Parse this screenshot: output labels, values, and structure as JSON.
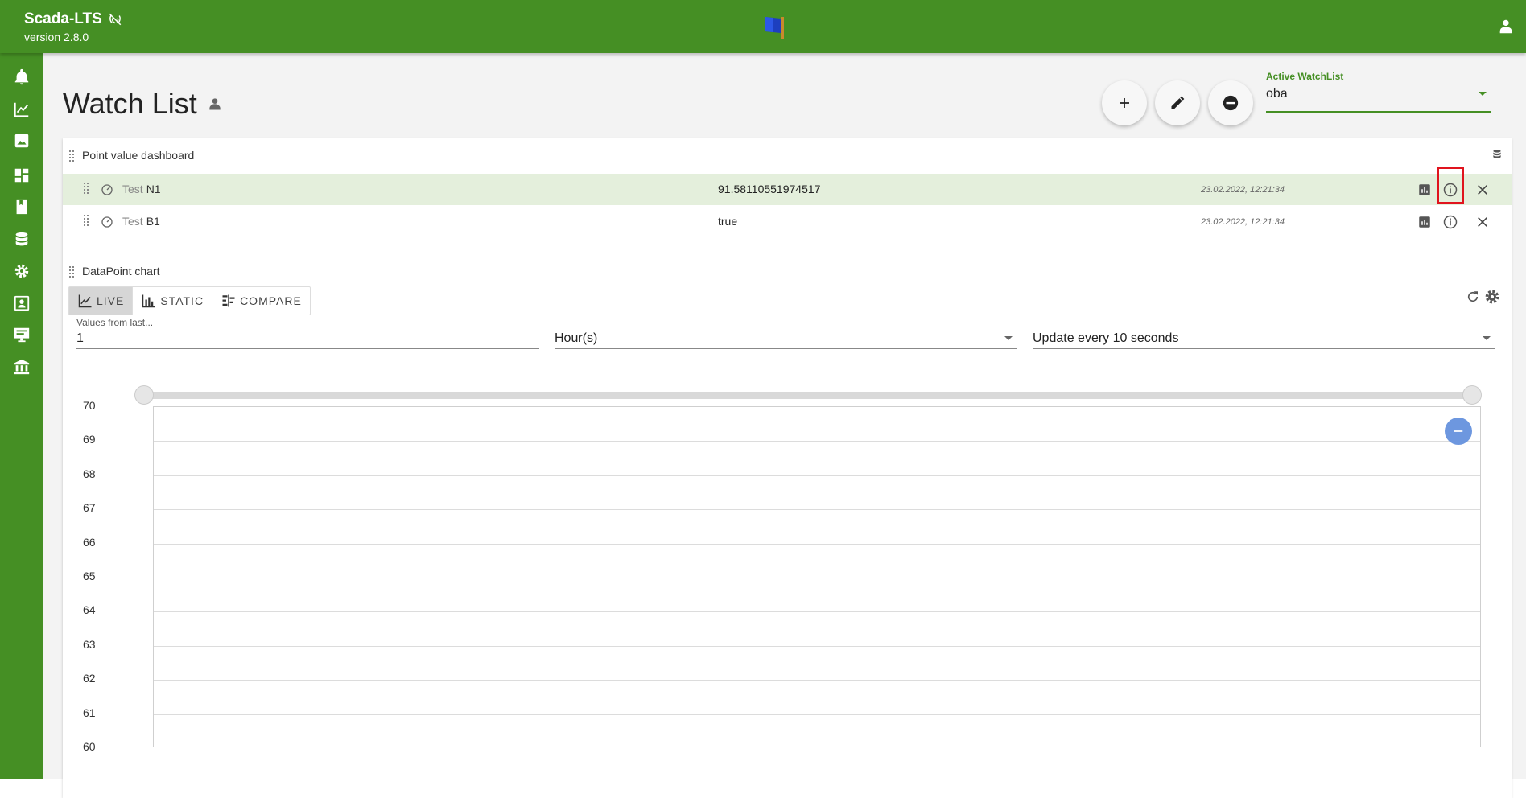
{
  "app": {
    "name": "Scada-LTS",
    "version": "version 2.8.0"
  },
  "page": {
    "title": "Watch List"
  },
  "watchlist_select": {
    "label": "Active WatchList",
    "value": "oba"
  },
  "dashboard": {
    "title": "Point value dashboard",
    "rows": [
      {
        "device": "Test",
        "name": "N1",
        "value": "91.58110551974517",
        "time": "23.02.2022, 12:21:34",
        "active": true
      },
      {
        "device": "Test",
        "name": "B1",
        "value": "true",
        "time": "23.02.2022, 12:21:34",
        "active": false
      }
    ]
  },
  "chart": {
    "title": "DataPoint chart",
    "tabs": [
      {
        "label": "LIVE",
        "selected": true
      },
      {
        "label": "STATIC",
        "selected": false
      },
      {
        "label": "COMPARE",
        "selected": false
      }
    ],
    "values_from": {
      "label": "Values from last...",
      "value": "1"
    },
    "period": {
      "value": "Hour(s)"
    },
    "update": {
      "value": "Update every 10 seconds"
    }
  },
  "chart_data": {
    "type": "line",
    "title": "",
    "xlabel": "",
    "ylabel": "",
    "ylim": [
      60,
      70
    ],
    "yticks": [
      "70",
      "69",
      "68",
      "67",
      "66",
      "65",
      "64",
      "63",
      "62",
      "61",
      "60"
    ],
    "series": [],
    "grid": true
  },
  "colors": {
    "brand": "#458f24",
    "highlight": "#e0141e",
    "zoom_button": "#6d97df"
  }
}
